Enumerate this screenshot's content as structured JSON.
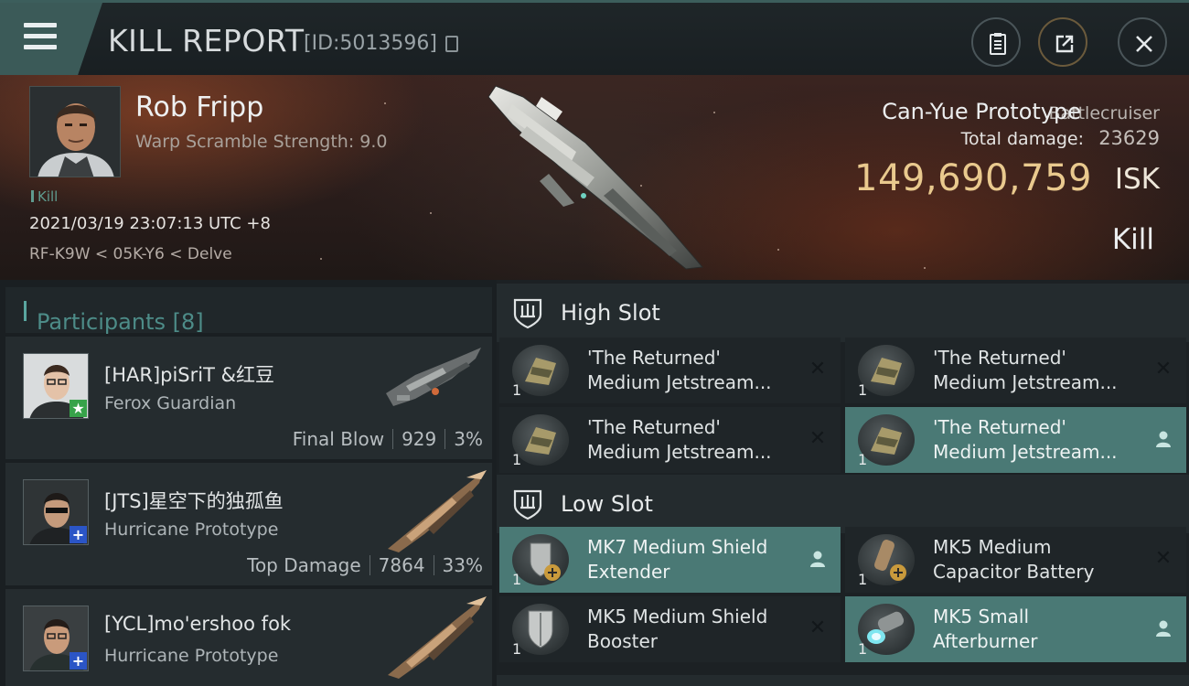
{
  "header": {
    "title": "KILL REPORT",
    "report_id": "[ID:5013596]",
    "icons": [
      "menu-icon",
      "copy-icon",
      "clipboard-icon",
      "share-icon",
      "close-icon"
    ]
  },
  "victim": {
    "name": "Rob Fripp",
    "attribute": "Warp Scramble Strength: 9.0",
    "tag": "Kill",
    "datetime": "2021/03/19 23:07:13 UTC +8",
    "location": "RF-K9W < 05K-Y6 < Delve",
    "ship_name": "Can-Yue Prototype",
    "ship_class": "Battlecruiser",
    "damage_label": "Total damage:",
    "damage_value": "23629",
    "isk_value": "149,690,759",
    "isk_unit": "ISK",
    "result": "Kill"
  },
  "participants": {
    "label": "Participants",
    "count": "[8]",
    "items": [
      {
        "name": "[HAR]piSriT &红豆",
        "ship": "Ferox Guardian",
        "role": "Final Blow",
        "damage": "929",
        "percent": "3%",
        "badge": "★"
      },
      {
        "name": "[JTS]星空下的独孤鱼",
        "ship": "Hurricane Prototype",
        "role": "Top Damage",
        "damage": "7864",
        "percent": "33%",
        "badge": "+"
      },
      {
        "name": "[YCL]mo'ershoo fok",
        "ship": "Hurricane Prototype",
        "role": "",
        "damage": "",
        "percent": "",
        "badge": "+"
      }
    ]
  },
  "fitting": {
    "high_slot": {
      "title": "High Slot",
      "modules": [
        {
          "line1": "'The Returned'",
          "line2": "Medium Jetstream...",
          "qty": "1",
          "status": "destroyed"
        },
        {
          "line1": "'The Returned'",
          "line2": "Medium Jetstream...",
          "qty": "1",
          "status": "destroyed"
        },
        {
          "line1": "'The Returned'",
          "line2": "Medium Jetstream...",
          "qty": "1",
          "status": "destroyed"
        },
        {
          "line1": "'The Returned'",
          "line2": "Medium Jetstream...",
          "qty": "1",
          "status": "dropped"
        }
      ]
    },
    "low_slot": {
      "title": "Low Slot",
      "modules": [
        {
          "line1": "MK7 Medium Shield",
          "line2": "Extender",
          "qty": "1",
          "status": "dropped"
        },
        {
          "line1": "MK5 Medium",
          "line2": "Capacitor Battery",
          "qty": "1",
          "status": "destroyed"
        },
        {
          "line1": "MK5 Medium Shield",
          "line2": "Booster",
          "qty": "1",
          "status": "destroyed"
        },
        {
          "line1": "MK5 Small",
          "line2": "Afterburner",
          "qty": "1",
          "status": "dropped"
        }
      ]
    }
  },
  "colors": {
    "accent_teal": "#4a7975",
    "isk_gold": "#e9c98e",
    "participants_teal": "#4d8c88"
  }
}
